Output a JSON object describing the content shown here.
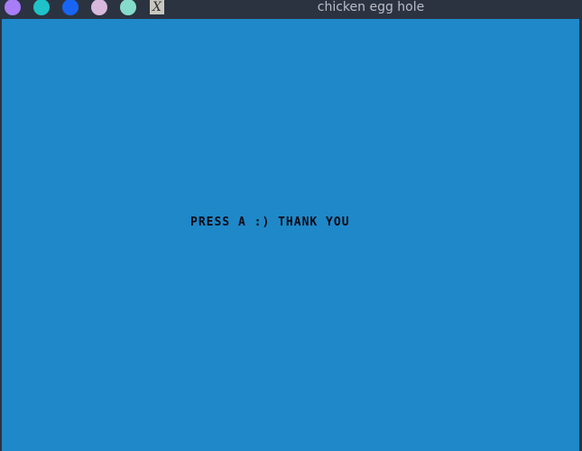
{
  "window": {
    "title": "chicken egg hole",
    "buttons": [
      {
        "name": "purple-dot",
        "color": "#a97cf8"
      },
      {
        "name": "teal-dot",
        "color": "#1fc2c9"
      },
      {
        "name": "blue-dot",
        "color": "#1865f5"
      },
      {
        "name": "pink-dot",
        "color": "#d8b8dc"
      },
      {
        "name": "mint-dot",
        "color": "#86dccb"
      }
    ],
    "close_icon": "x-icon",
    "close_glyph": "X"
  },
  "game": {
    "background_color": "#1e88c9",
    "message": "PRESS A :) THANK YOU"
  }
}
